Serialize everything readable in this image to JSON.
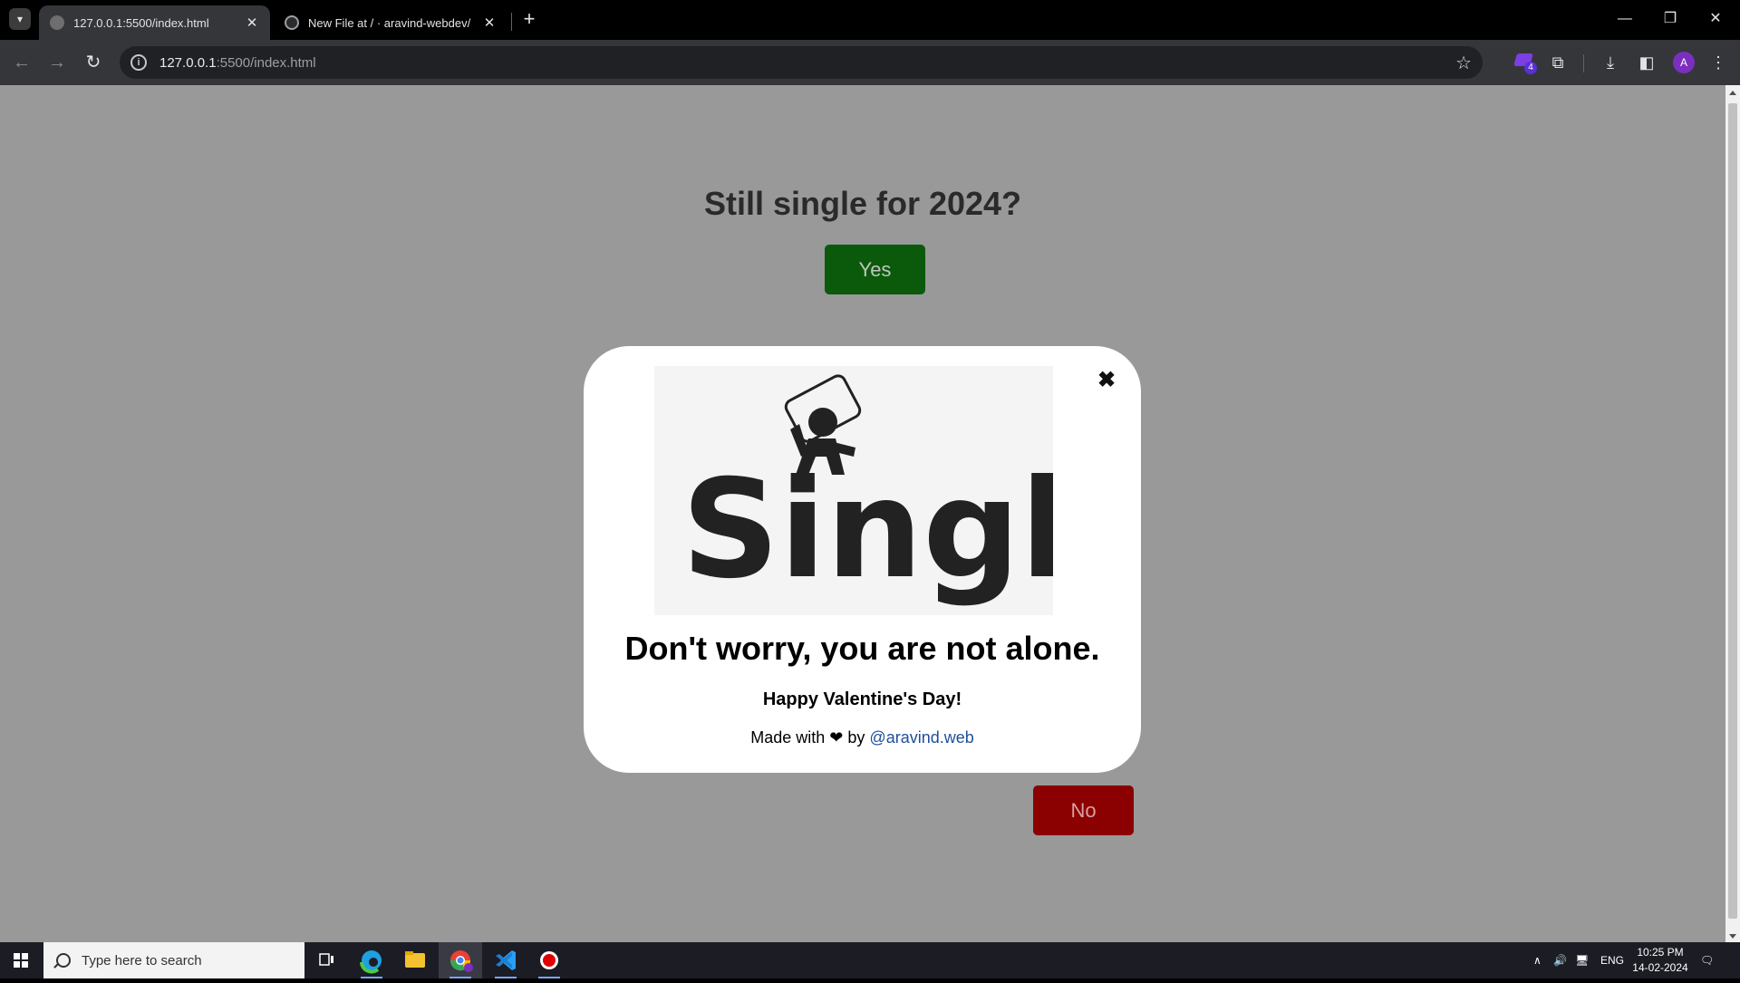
{
  "browser": {
    "tabs": [
      {
        "title": "127.0.0.1:5500/index.html",
        "close": "✕"
      },
      {
        "title": "New File at / · aravind-webdev/",
        "close": "✕"
      }
    ],
    "new_tab": "+",
    "window_controls": {
      "minimize": "—",
      "restore": "❐",
      "close": "✕"
    },
    "address": {
      "host": "127.0.0.1",
      "path": ":5500/index.html"
    },
    "extension_badge_count": "4",
    "profile_initial": "A"
  },
  "page": {
    "question": "Still single for 2024?",
    "yes_label": "Yes",
    "no_label": "No",
    "modal": {
      "close_label": "✖",
      "image_word": "Single",
      "heading": "Don't worry, you are not alone.",
      "subheading": "Happy Valentine's Day!",
      "credit_prefix": "Made with",
      "credit_heart": "❤",
      "credit_by": "by",
      "credit_link": "@aravind.web"
    }
  },
  "taskbar": {
    "search_placeholder": "Type here to search",
    "language": "ENG",
    "time": "10:25 PM",
    "date": "14-02-2024"
  }
}
